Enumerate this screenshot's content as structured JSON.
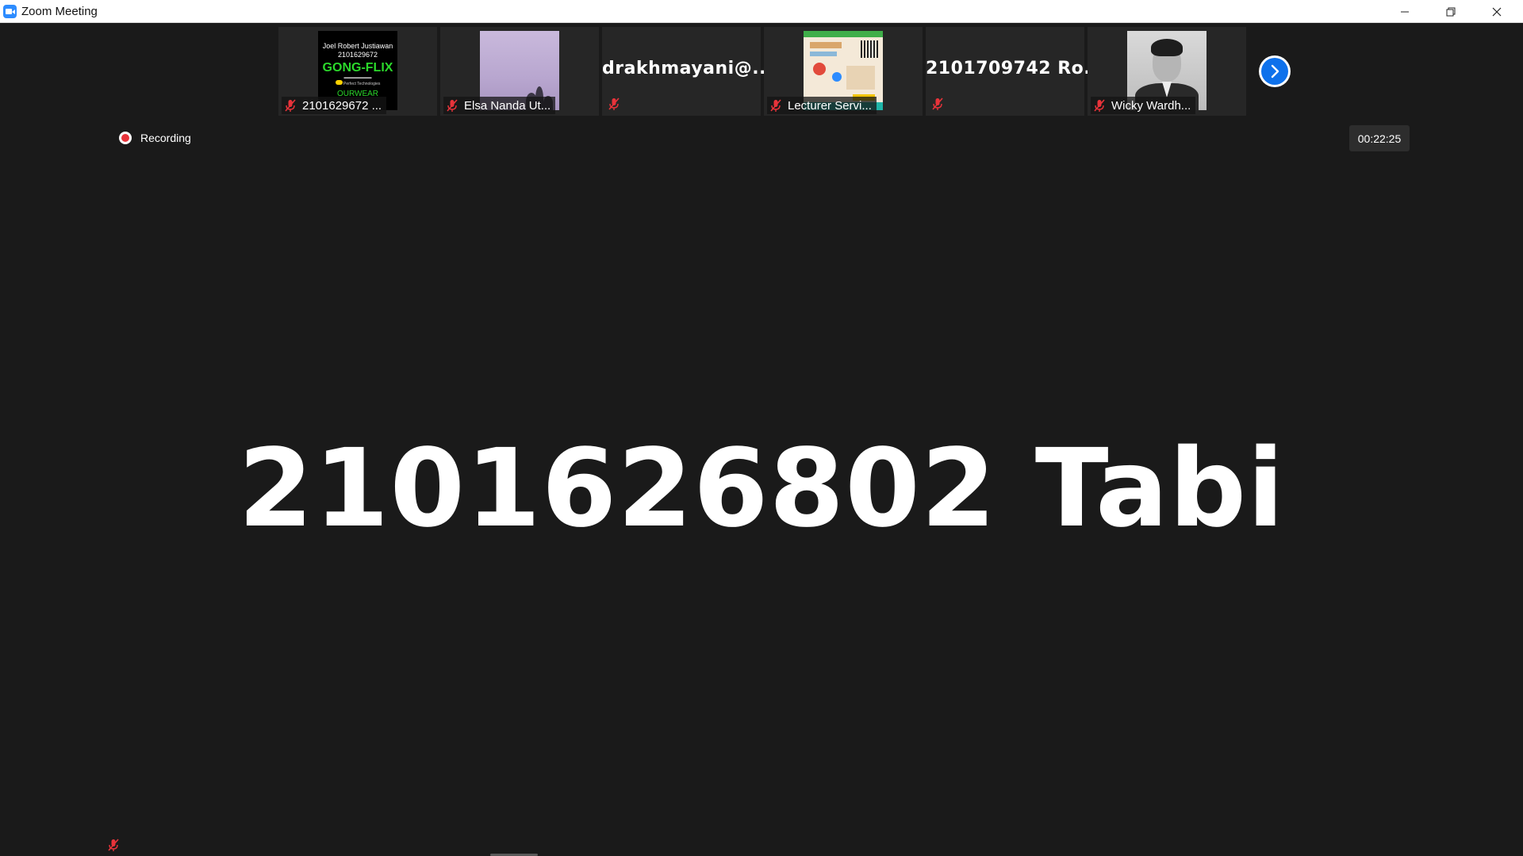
{
  "window": {
    "title": "Zoom Meeting",
    "controls": [
      "minimize-icon",
      "restore-icon",
      "close-icon"
    ]
  },
  "participants": [
    {
      "name": "2101629672 ...",
      "muted": true,
      "thumbnail": {
        "type": "poster",
        "line1": "Joel Robert Justiawan",
        "line2": "2101629672",
        "headline": "GONG-FLIX",
        "tagline": "Perfect Technologies",
        "footer": "OURWEAR"
      }
    },
    {
      "name": "Elsa Nanda Ut...",
      "muted": true,
      "thumbnail": {
        "type": "sky-photo"
      }
    },
    {
      "name": "drakhmayani@...",
      "muted": true,
      "thumbnail": {
        "type": "name-only"
      }
    },
    {
      "name": "Lecturer Servi...",
      "muted": true,
      "thumbnail": {
        "type": "infographic"
      }
    },
    {
      "name": "2101709742 Ro...",
      "muted": true,
      "thumbnail": {
        "type": "name-only"
      }
    },
    {
      "name": "Wicky Wardh...",
      "muted": true,
      "thumbnail": {
        "type": "portrait-photo"
      }
    }
  ],
  "strip": {
    "next_icon": "chevron-right-icon"
  },
  "recording": {
    "label": "Recording"
  },
  "timer": {
    "value": "00:22:25"
  },
  "active_speaker": {
    "name": "210162680 2 Tabi",
    "display_name": "2101626802 Tabi",
    "muted": true
  },
  "colors": {
    "background": "#1a1a1a",
    "tile": "#262626",
    "accent_blue": "#0e71eb",
    "mute_red": "#e8333a",
    "recording_red": "#e8333a"
  }
}
